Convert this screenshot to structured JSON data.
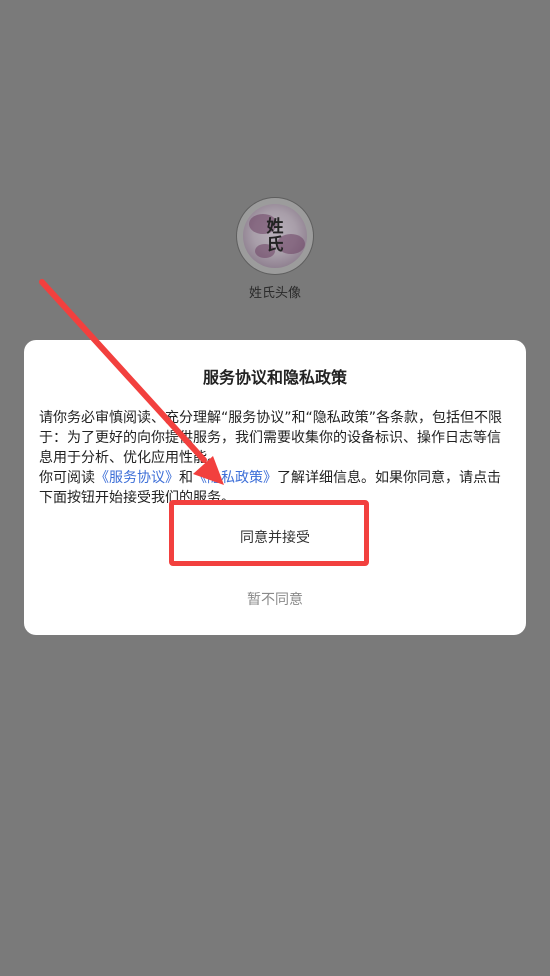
{
  "app": {
    "logo_glyphs": [
      "姓",
      "氏"
    ],
    "name": "姓氏头像"
  },
  "dialog": {
    "title": "服务协议和隐私政策",
    "para1": "请你务必审慎阅读、充分理解“服务协议”和“隐私政策”各条款，包括但不限于：为了更好的向你提供服务，我们需要收集你的设备标识、操作日志等信息用于分析、优化应用性能。",
    "para2_prefix": "你可阅读",
    "link_service": "《服务协议》",
    "para2_and": "和",
    "link_privacy": "《隐私政策》",
    "para2_suffix": "了解详细信息。如果你同意，请点击下面按钮开始接受我们的服务。",
    "agree_label": "同意并接受",
    "disagree_label": "暂不同意"
  },
  "annotation": {
    "color": "#f2403e"
  }
}
